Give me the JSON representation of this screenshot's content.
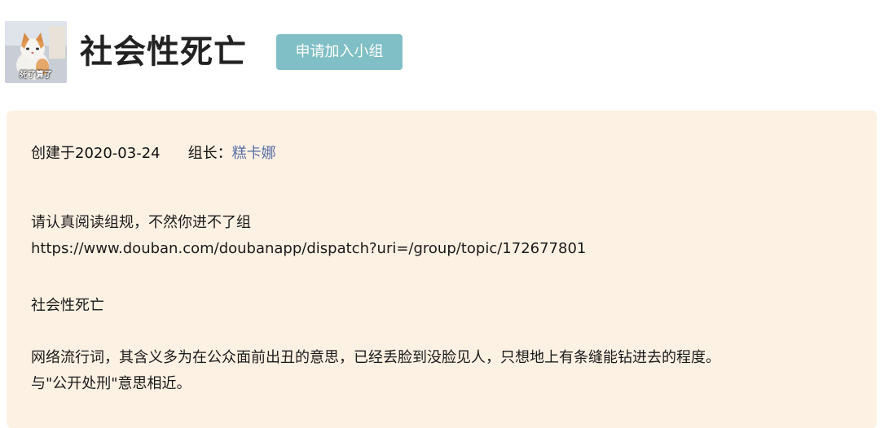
{
  "group": {
    "title": "社会性死亡",
    "avatar_caption": "死了算了",
    "join_button": "申请加入小组"
  },
  "meta": {
    "created": "创建于2020-03-24",
    "owner_label": "组长：",
    "owner_name": "糕卡娜"
  },
  "description": {
    "rules_notice": "请认真阅读组规，不然你进不了组",
    "rules_link": "https://www.douban.com/doubanapp/dispatch?uri=/group/topic/172677801",
    "term": "社会性死亡",
    "definition_line1": "网络流行词，其含义多为在公众面前出丑的意思，已经丢脸到没脸见人，只想地上有条缝能钻进去的程度。",
    "definition_line2": "与\"公开处刑\"意思相近。"
  },
  "colors": {
    "button_bg": "#7fbfc5",
    "panel_bg": "#fdf1e3",
    "owner_link": "#5a6fa6"
  }
}
